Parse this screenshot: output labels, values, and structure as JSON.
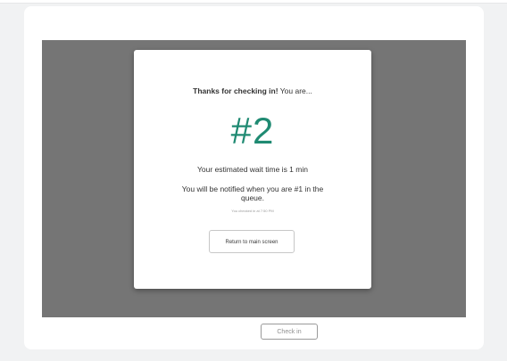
{
  "background_button": {
    "label": "Check in"
  },
  "modal": {
    "headline_bold": "Thanks for checking in!",
    "headline_rest": " You are...",
    "queue_position": "#2",
    "wait_time_text": "Your estimated wait time is 1 min",
    "notify_text": "You will be notified when you are #1 in the queue.",
    "checked_in_text": "You checked in at 7:50 PM",
    "return_button_label": "Return to main screen"
  },
  "colors": {
    "accent": "#1f8a72",
    "overlay": "#757575",
    "background": "#f1f2f3"
  }
}
